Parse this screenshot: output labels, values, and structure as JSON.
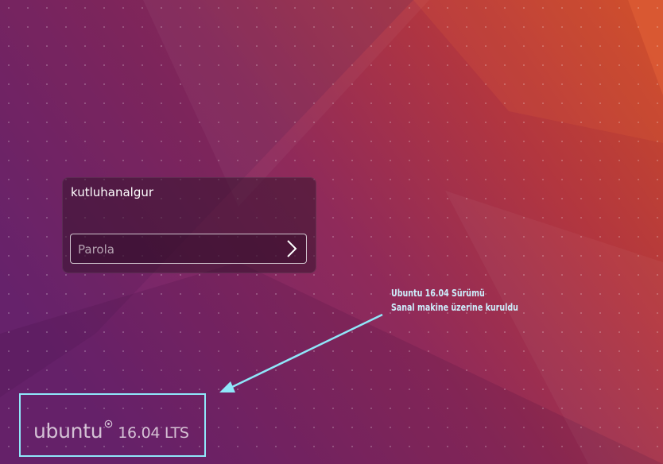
{
  "login": {
    "username": "kutluhanalgur",
    "password_placeholder": "Parola"
  },
  "annotation": {
    "line1": "Ubuntu 16.04 Sürümü",
    "line2": "Sanal makine üzerine kuruldu"
  },
  "branding": {
    "word": "ubuntu",
    "version": "16.04 LTS"
  },
  "colors": {
    "annotation_text": "#cdeefc",
    "highlight_border": "#8fe7fa",
    "background_left": "#6b2670",
    "background_right": "#c2422e"
  }
}
